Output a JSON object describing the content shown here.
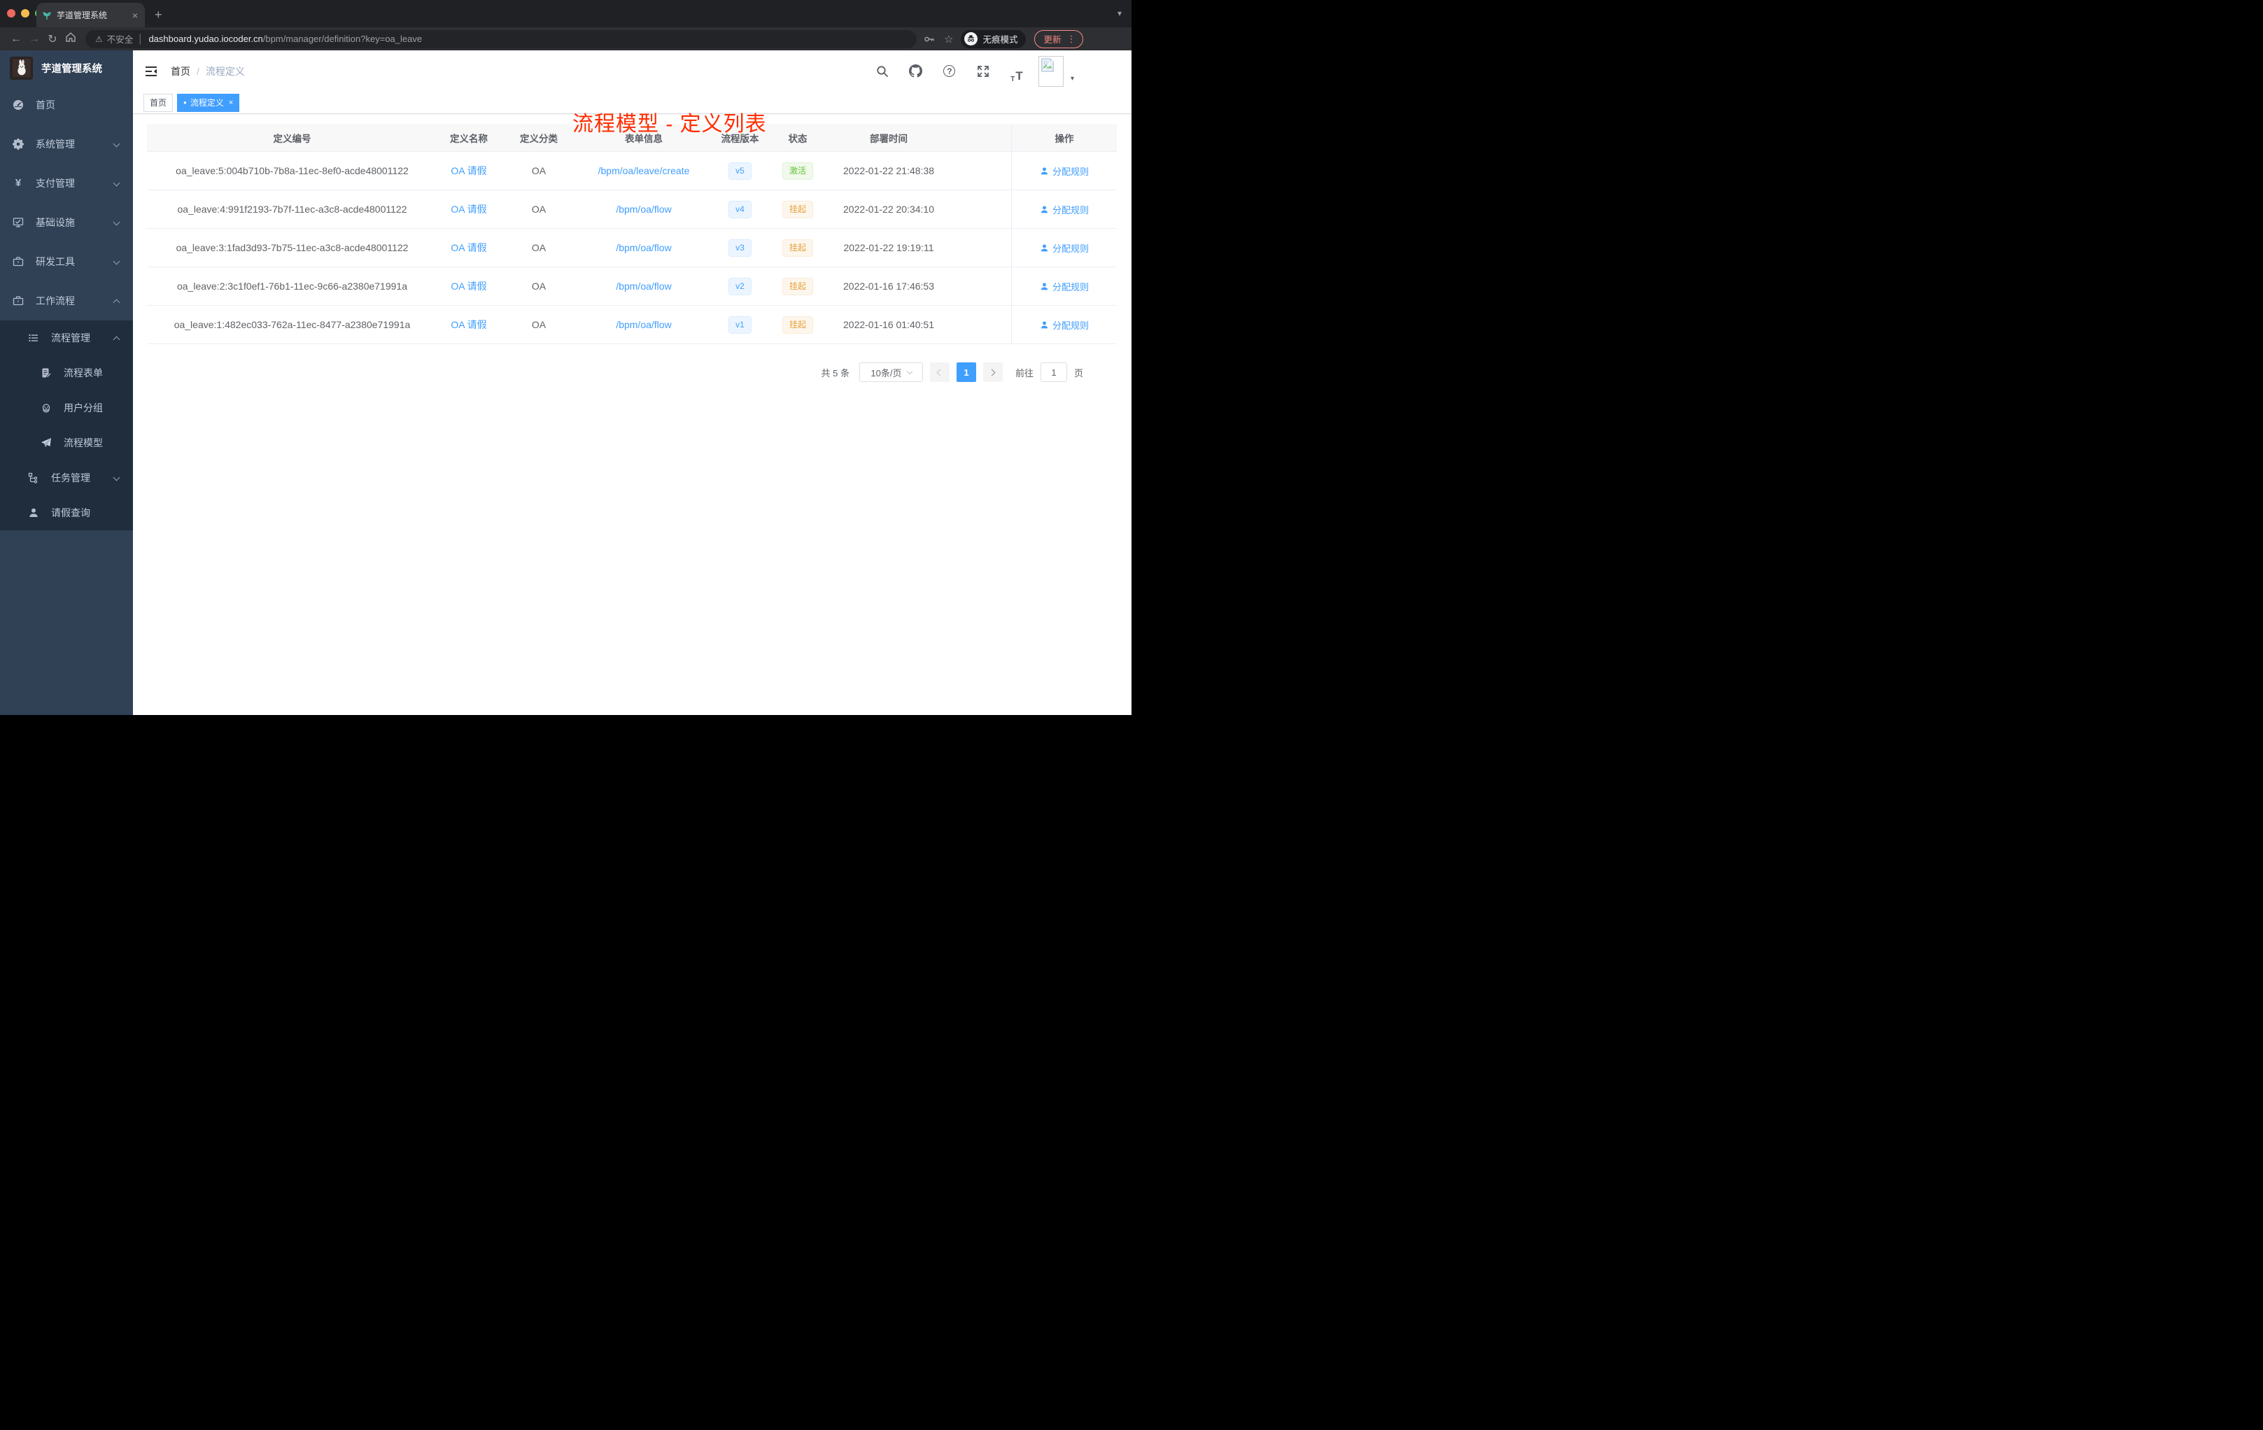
{
  "browser": {
    "tab_title": "芋道管理系统",
    "security_label": "不安全",
    "url_host": "dashboard.yudao.iocoder.cn",
    "url_path": "/bpm/manager/definition?key=oa_leave",
    "incognito_label": "无痕模式",
    "update_label": "更新"
  },
  "glyphs": {
    "close": "×",
    "plus": "+",
    "back": "←",
    "forward": "→",
    "reload": "↻",
    "star": "☆",
    "warning": "⚠",
    "kebab": "⋮",
    "caret_down": "▾",
    "dot": "●",
    "question": "?",
    "divider": "|",
    "font_small": "T",
    "font_large": "T"
  },
  "sidebar": {
    "app_title": "芋道管理系统",
    "items": [
      {
        "label": "首页",
        "icon": "dashboard-icon"
      },
      {
        "label": "系统管理",
        "icon": "gear-icon",
        "state": "collapsed"
      },
      {
        "label": "支付管理",
        "icon": "yen-icon",
        "state": "collapsed"
      },
      {
        "label": "基础设施",
        "icon": "monitor-icon",
        "state": "collapsed"
      },
      {
        "label": "研发工具",
        "icon": "toolbox-icon",
        "state": "collapsed"
      },
      {
        "label": "工作流程",
        "icon": "briefcase-icon",
        "state": "expanded"
      }
    ],
    "workflow_submenu": {
      "process_group": {
        "label": "流程管理",
        "state": "expanded"
      },
      "process_children": [
        {
          "label": "流程表单",
          "icon": "form-icon"
        },
        {
          "label": "用户分组",
          "icon": "user-group-icon"
        },
        {
          "label": "流程模型",
          "icon": "paper-plane-icon"
        }
      ],
      "task_group": {
        "label": "任务管理",
        "state": "collapsed"
      },
      "leave_item": {
        "label": "请假查询",
        "icon": "person-icon"
      }
    }
  },
  "header": {
    "breadcrumb": [
      "首页",
      "流程定义"
    ],
    "breadcrumb_separator": "/",
    "annotation": "流程模型 - 定义列表"
  },
  "tags": [
    {
      "label": "首页",
      "active": false
    },
    {
      "label": "流程定义",
      "active": true,
      "closable": true
    }
  ],
  "table": {
    "columns": [
      "定义编号",
      "定义名称",
      "定义分类",
      "表单信息",
      "流程版本",
      "状态",
      "部署时间",
      "操作"
    ],
    "rows": [
      {
        "id": "oa_leave:5:004b710b-7b8a-11ec-8ef0-acde48001122",
        "name": "OA 请假",
        "category": "OA",
        "form": "/bpm/oa/leave/create",
        "version": "v5",
        "status": "激活",
        "status_type": "success",
        "deploy_time": "2022-01-22 21:48:38",
        "action": "分配规则"
      },
      {
        "id": "oa_leave:4:991f2193-7b7f-11ec-a3c8-acde48001122",
        "name": "OA 请假",
        "category": "OA",
        "form": "/bpm/oa/flow",
        "version": "v4",
        "status": "挂起",
        "status_type": "warning",
        "deploy_time": "2022-01-22 20:34:10",
        "action": "分配规则"
      },
      {
        "id": "oa_leave:3:1fad3d93-7b75-11ec-a3c8-acde48001122",
        "name": "OA 请假",
        "category": "OA",
        "form": "/bpm/oa/flow",
        "version": "v3",
        "status": "挂起",
        "status_type": "warning",
        "deploy_time": "2022-01-22 19:19:11",
        "action": "分配规则"
      },
      {
        "id": "oa_leave:2:3c1f0ef1-76b1-11ec-9c66-a2380e71991a",
        "name": "OA 请假",
        "category": "OA",
        "form": "/bpm/oa/flow",
        "version": "v2",
        "status": "挂起",
        "status_type": "warning",
        "deploy_time": "2022-01-16 17:46:53",
        "action": "分配规则"
      },
      {
        "id": "oa_leave:1:482ec033-762a-11ec-8477-a2380e71991a",
        "name": "OA 请假",
        "category": "OA",
        "form": "/bpm/oa/flow",
        "version": "v1",
        "status": "挂起",
        "status_type": "warning",
        "deploy_time": "2022-01-16 01:40:51",
        "action": "分配规则"
      }
    ]
  },
  "pagination": {
    "total_label": "共 5 条",
    "page_size": "10条/页",
    "current_page": "1",
    "goto_label": "前往",
    "goto_value": "1",
    "page_unit": "页"
  },
  "colors": {
    "accent": "#409eff",
    "annotation": "#ff2d00",
    "sidebar_bg": "#304156",
    "submenu_bg": "#1f2d3d",
    "success": "#67c23a",
    "warning": "#e6a23c"
  }
}
